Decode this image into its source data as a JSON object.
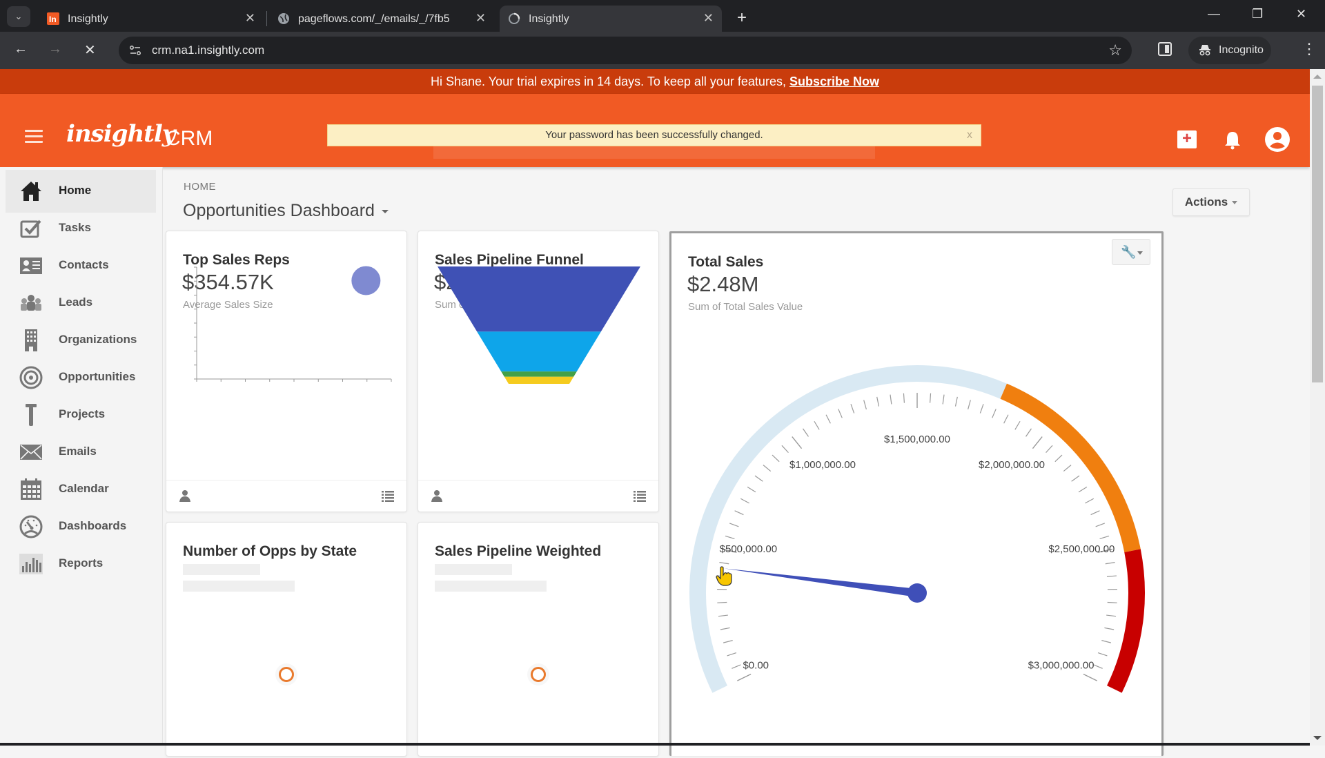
{
  "browser": {
    "tabs": [
      {
        "title": "Insightly",
        "icon": "insightly-favicon",
        "active": false
      },
      {
        "title": "pageflows.com/_/emails/_/7fb5",
        "icon": "globe-icon",
        "active": false
      },
      {
        "title": "Insightly",
        "icon": "loading-spinner-icon",
        "active": true
      }
    ],
    "url": "crm.na1.insightly.com",
    "incognito_label": "Incognito",
    "icons": {
      "tab_search": "⌄",
      "close": "✕",
      "new_tab": "+",
      "minimize": "—",
      "restore": "❐",
      "window_close": "✕",
      "back": "←",
      "forward": "→",
      "stop": "✕",
      "site_info": "⚙",
      "star": "☆",
      "incognito": "🕵",
      "menu": "⋮"
    }
  },
  "banner": {
    "text": "Hi Shane. Your trial expires in 14 days. To keep all your features,",
    "link": "Subscribe Now"
  },
  "header": {
    "logo": "insightly",
    "product": "CRM",
    "flash_message": "Your password has been successfully changed.",
    "flash_close": "x"
  },
  "sidebar": {
    "items": [
      {
        "label": "Home",
        "icon": "home-icon",
        "active": true
      },
      {
        "label": "Tasks",
        "icon": "tasks-icon"
      },
      {
        "label": "Contacts",
        "icon": "contacts-icon"
      },
      {
        "label": "Leads",
        "icon": "leads-icon"
      },
      {
        "label": "Organizations",
        "icon": "organizations-icon"
      },
      {
        "label": "Opportunities",
        "icon": "opportunities-icon"
      },
      {
        "label": "Projects",
        "icon": "projects-icon"
      },
      {
        "label": "Emails",
        "icon": "emails-icon"
      },
      {
        "label": "Calendar",
        "icon": "calendar-icon"
      },
      {
        "label": "Dashboards",
        "icon": "dashboards-icon"
      },
      {
        "label": "Reports",
        "icon": "reports-icon"
      }
    ]
  },
  "page": {
    "breadcrumb": "HOME",
    "title": "Opportunities Dashboard",
    "actions_label": "Actions"
  },
  "cards": {
    "top_sales_reps": {
      "title": "Top Sales Reps",
      "value": "$354.57K",
      "subtitle": "Average Sales Size"
    },
    "funnel": {
      "title": "Sales Pipeline Funnel",
      "value": "$2.45M",
      "subtitle": "Sum of Opportunity Value"
    },
    "total_sales": {
      "title": "Total Sales",
      "value": "$2.48M",
      "subtitle": "Sum of Total Sales Value"
    },
    "opps_by_state": {
      "title": "Number of Opps by State",
      "loading": true
    },
    "pipeline_weighted": {
      "title": "Sales Pipeline Weighted",
      "loading": true
    }
  },
  "chart_data": [
    {
      "type": "scatter",
      "title": "Top Sales Reps",
      "xlabel": "",
      "ylabel": "",
      "points": [
        {
          "x": 0.87,
          "y": 0.88
        }
      ],
      "x_ticks": 9,
      "y_ticks": 9,
      "grid": false,
      "color": "#7f8ad1"
    },
    {
      "type": "funnel",
      "title": "Sales Pipeline Funnel",
      "stages": [
        {
          "share": 0.555,
          "color": "#3f51b5"
        },
        {
          "share": 0.34,
          "color": "#0ea5ea"
        },
        {
          "share": 0.045,
          "color": "#43a047"
        },
        {
          "share": 0.06,
          "color": "#f5cb1e"
        }
      ]
    },
    {
      "type": "gauge",
      "title": "Total Sales",
      "min": 0,
      "max": 3000000,
      "major_ticks": [
        0,
        500000,
        1000000,
        1500000,
        2000000,
        2500000,
        3000000
      ],
      "tick_labels": [
        "$0.00",
        "$500,000.00",
        "$1,000,000.00",
        "$1,500,000.00",
        "$2,000,000.00",
        "$2,500,000.00",
        "$3,000,000.00"
      ],
      "minor_ticks_per_major": 10,
      "bands": [
        {
          "from": 0,
          "to": 1800000,
          "color": "#d9e9f3"
        },
        {
          "from": 1800000,
          "to": 2520000,
          "color": "#f07f0f"
        },
        {
          "from": 2520000,
          "to": 3000000,
          "color": "#c80000"
        }
      ],
      "needle_value": 430000,
      "needle_color": "#3f4fb8"
    }
  ]
}
